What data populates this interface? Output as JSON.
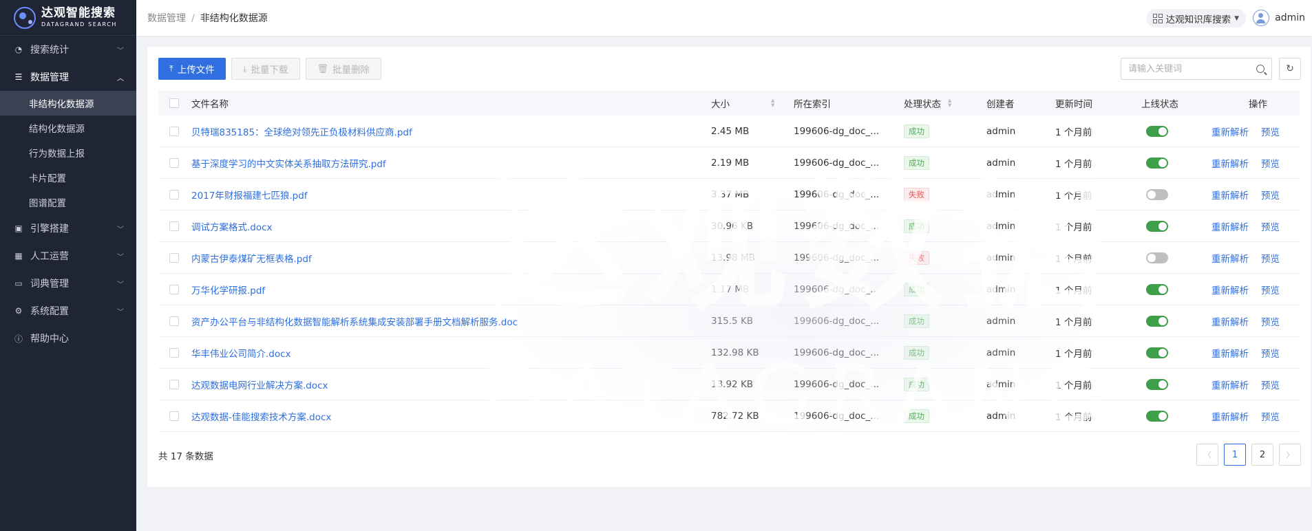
{
  "brand": {
    "name_cn": "达观智能搜索",
    "name_en": "DATAGRAND SEARCH"
  },
  "sidebar": {
    "items": [
      {
        "label": "搜索统计",
        "icon": "pie-chart-icon",
        "expanded": false
      },
      {
        "label": "数据管理",
        "icon": "database-icon",
        "expanded": true,
        "children": [
          {
            "label": "非结构化数据源",
            "active": true
          },
          {
            "label": "结构化数据源"
          },
          {
            "label": "行为数据上报"
          },
          {
            "label": "卡片配置"
          },
          {
            "label": "图谱配置"
          }
        ]
      },
      {
        "label": "引擎搭建",
        "icon": "engine-icon",
        "expanded": false
      },
      {
        "label": "人工运营",
        "icon": "operation-icon",
        "expanded": false
      },
      {
        "label": "词典管理",
        "icon": "book-icon",
        "expanded": false
      },
      {
        "label": "系统配置",
        "icon": "gear-icon",
        "expanded": false
      },
      {
        "label": "帮助中心",
        "icon": "info-icon"
      }
    ]
  },
  "header": {
    "breadcrumb": {
      "parent": "数据管理",
      "separator": "/",
      "current": "非结构化数据源"
    },
    "kb_select": "达观知识库搜索",
    "user": "admin"
  },
  "toolbar": {
    "upload": "上传文件",
    "batch_download": "批量下载",
    "batch_delete": "批量删除",
    "search_placeholder": "请输入关键词"
  },
  "table": {
    "columns": {
      "name": "文件名称",
      "size": "大小",
      "index": "所在索引",
      "status": "处理状态",
      "creator": "创建者",
      "updated": "更新时间",
      "online": "上线状态",
      "ops": "操作"
    },
    "rows": [
      {
        "name": "贝特瑞835185：全球绝对领先正负极材料供应商.pdf",
        "size": "2.45 MB",
        "index": "199606-dg_doc_...",
        "status": "成功",
        "status_ok": true,
        "creator": "admin",
        "updated": "1 个月前",
        "online": true
      },
      {
        "name": "基于深度学习的中文实体关系抽取方法研究.pdf",
        "size": "2.19 MB",
        "index": "199606-dg_doc_...",
        "status": "成功",
        "status_ok": true,
        "creator": "admin",
        "updated": "1 个月前",
        "online": true
      },
      {
        "name": "2017年财报福建七匹狼.pdf",
        "size": "3.37 MB",
        "index": "199606-dg_doc_...",
        "status": "失败",
        "status_ok": false,
        "creator": "admin",
        "updated": "1 个月前",
        "online": false
      },
      {
        "name": "调试方案格式.docx",
        "size": "30.96 KB",
        "index": "199606-dg_doc_...",
        "status": "成功",
        "status_ok": true,
        "creator": "admin",
        "updated": "1 个月前",
        "online": true
      },
      {
        "name": "内蒙古伊泰煤矿无框表格.pdf",
        "size": "13.98 MB",
        "index": "199606-dg_doc_...",
        "status": "失败",
        "status_ok": false,
        "creator": "admin",
        "updated": "1 个月前",
        "online": false
      },
      {
        "name": "万华化学研报.pdf",
        "size": "1.17 MB",
        "index": "199606-dg_doc_...",
        "status": "成功",
        "status_ok": true,
        "creator": "admin",
        "updated": "1 个月前",
        "online": true
      },
      {
        "name": "资产办公平台与非结构化数据智能解析系统集成安装部署手册文档解析服务.doc",
        "size": "315.5 KB",
        "index": "199606-dg_doc_...",
        "status": "成功",
        "status_ok": true,
        "creator": "admin",
        "updated": "1 个月前",
        "online": true
      },
      {
        "name": "华丰伟业公司简介.docx",
        "size": "132.98 KB",
        "index": "199606-dg_doc_...",
        "status": "成功",
        "status_ok": true,
        "creator": "admin",
        "updated": "1 个月前",
        "online": true
      },
      {
        "name": "达观数据电网行业解决方案.docx",
        "size": "13.92 KB",
        "index": "199606-dg_doc_...",
        "status": "成功",
        "status_ok": true,
        "creator": "admin",
        "updated": "1 个月前",
        "online": true
      },
      {
        "name": "达观数据-佳能搜索技术方案.docx",
        "size": "782.72 KB",
        "index": "199606-dg_doc_...",
        "status": "成功",
        "status_ok": true,
        "creator": "admin",
        "updated": "1 个月前",
        "online": true
      }
    ],
    "row_ops": {
      "reparse": "重新解析",
      "preview": "预览"
    }
  },
  "pagination": {
    "total": "共 17 条数据",
    "pages": [
      "1",
      "2"
    ],
    "current": "1"
  },
  "watermark": {
    "cn": "达观数据",
    "en": "DATAGRAND"
  },
  "colors": {
    "primary": "#2f6fdf",
    "sidebar_bg": "#1f2535",
    "success": "#52a85a",
    "danger": "#e05b5b",
    "switch_on": "#3f9e4a"
  }
}
